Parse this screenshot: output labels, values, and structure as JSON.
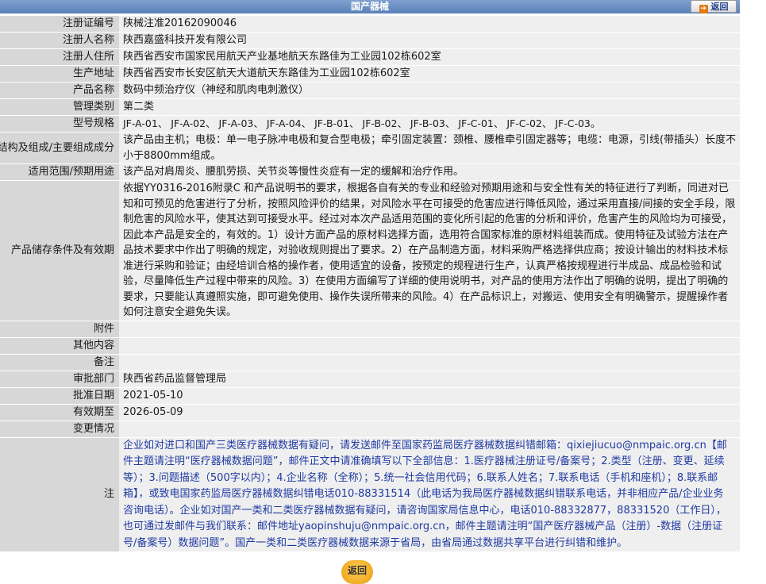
{
  "header": {
    "title": "国产器械",
    "back_label": "返回"
  },
  "fields": [
    {
      "label": "注册证编号",
      "value": "陕械注准20162090046"
    },
    {
      "label": "注册人名称",
      "value": "陕西嘉盛科技开发有限公司"
    },
    {
      "label": "注册人住所",
      "value": "陕西省西安市国家民用航天产业基地航天东路佳为工业园102栋602室"
    },
    {
      "label": "生产地址",
      "value": "陕西省西安市长安区航天大道航天东路佳为工业园102栋602室"
    },
    {
      "label": "产品名称",
      "value": "数码中频治疗仪（神经和肌肉电刺激仪）"
    },
    {
      "label": "管理类别",
      "value": "第二类"
    },
    {
      "label": "型号规格",
      "value": "JF-A-01、 JF-A-02、 JF-A-03、 JF-A-04、 JF-B-01、 JF-B-02、 JF-B-03、 JF-C-01、 JF-C-02、 JF-C-03。"
    },
    {
      "label": "结构及组成/主要组成成分",
      "value": "该产品由主机；电极：单一电子脉冲电极和复合型电极；牵引固定装置：颈椎、腰椎牵引固定器等；电缆：电源，引线(带插头）长度不小于8800mm组成。"
    },
    {
      "label": "适用范围/预期用途",
      "value": "该产品对肩周炎、腰肌劳损、关节炎等慢性炎症有一定的缓解和治疗作用。"
    },
    {
      "label": "产品储存条件及有效期",
      "value": "依据YY0316-2016附录C 和产品说明书的要求，根据各自有关的专业和经验对预期用途和与安全性有关的特征进行了判断，同进对已知和可预见的危害进行了分析，按照风险评价的结果，对风险水平在可接受的危害应进行降低风险，通过采用直接/间接的安全手段，限制危害的风险水平，使其达到可接受水平。经过对本次产品适用范围的变化所引起的危害的分析和评价，危害产生的风险均为可接受，因此本产品是安全的，有效的。1）设计方面产品的原材料选择方面，选用符合国家标准的原材料组装而成。使用特征及试验方法在产品技术要求中作出了明确的规定，对验收规则提出了要求。2）在产品制造方面，材料采购严格选择供应商；按设计输出的材料技术标准进行采购和验证；由经培训合格的操作者，使用适宜的设备，按预定的规程进行生产，认真严格按规程进行半成品、成品检验和试验，尽量降低生产过程中带来的风险。3）在使用方面编写了详细的使用说明书，对产品的使用方法作出了明确的说明，提出了明确的要求，只要能认真遵照实施，即可避免使用、操作失误所带来的风险。4）在产品标识上，对搬运、使用安全有明确警示，提醒操作者如何注意安全避免失误。"
    },
    {
      "label": "附件",
      "value": ""
    },
    {
      "label": "其他内容",
      "value": ""
    },
    {
      "label": "备注",
      "value": ""
    },
    {
      "label": "审批部门",
      "value": "陕西省药品监督管理局"
    },
    {
      "label": "批准日期",
      "value": "2021-05-10"
    },
    {
      "label": "有效期至",
      "value": "2026-05-09"
    },
    {
      "label": "变更情况",
      "value": ""
    }
  ],
  "note": {
    "label": "注",
    "text": "企业如对进口和国产三类医疗器械数据有疑问，请发送邮件至国家药监局医疗器械数据纠错邮箱：qixiejiucuo@nmpaic.org.cn【邮件主题请注明“医疗器械数据问题”，邮件正文中请准确填写以下全部信息：1.医疗器械注册证号/备案号；2.类型（注册、变更、延续等）；3.问题描述（500字以内）；4.企业名称（全称）；5.统一社会信用代码；6.联系人姓名；7.联系电话（手机和座机）；8.联系邮箱】，或致电国家药监局医疗器械数据纠错电话010-88331514（此电话为我局医疗器械数据纠错联系电话，并非相应产品/企业业务咨询电话）。企业如对国产一类和二类医疗器械数据有疑问，请咨询国家局信息中心，电话010-88332877，88331520（工作日），也可通过发邮件与我们联系：邮件地址yaopinshuju@nmpaic.org.cn，邮件主题请注明“国产医疗器械产品（注册）-数据（注册证号/备案号）数据问题”。国产一类和二类医疗器械数据来源于省局，由省局通过数据共享平台进行纠错和维护。"
  },
  "footer": {
    "back_label": "返回"
  }
}
